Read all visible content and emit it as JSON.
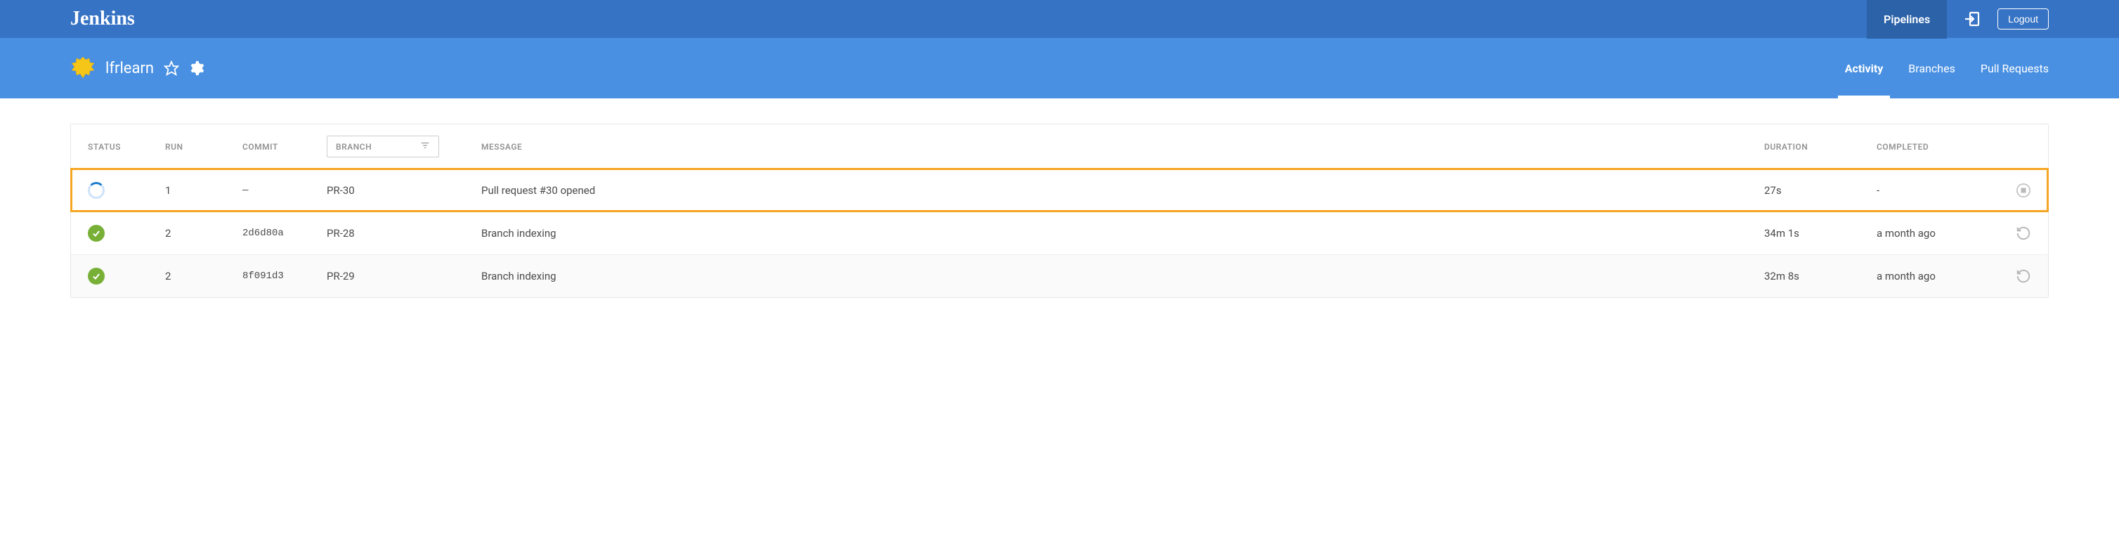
{
  "topbar": {
    "brand": "Jenkins",
    "pipelines_label": "Pipelines",
    "logout_label": "Logout"
  },
  "project": {
    "name": "lfrlearn"
  },
  "subtabs": {
    "activity": "Activity",
    "branches": "Branches",
    "pull_requests": "Pull Requests"
  },
  "columns": {
    "status": "STATUS",
    "run": "RUN",
    "commit": "COMMIT",
    "branch": "BRANCH",
    "message": "MESSAGE",
    "duration": "DURATION",
    "completed": "COMPLETED"
  },
  "rows": [
    {
      "status": "running",
      "run": "1",
      "commit": "—",
      "branch": "PR-30",
      "message": "Pull request #30 opened",
      "duration": "27s",
      "completed": "-",
      "action": "stop",
      "highlighted": true
    },
    {
      "status": "success",
      "run": "2",
      "commit": "2d6d80a",
      "branch": "PR-28",
      "message": "Branch indexing",
      "duration": "34m 1s",
      "completed": "a month ago",
      "action": "rerun",
      "highlighted": false
    },
    {
      "status": "success",
      "run": "2",
      "commit": "8f091d3",
      "branch": "PR-29",
      "message": "Branch indexing",
      "duration": "32m 8s",
      "completed": "a month ago",
      "action": "rerun",
      "highlighted": false
    }
  ]
}
